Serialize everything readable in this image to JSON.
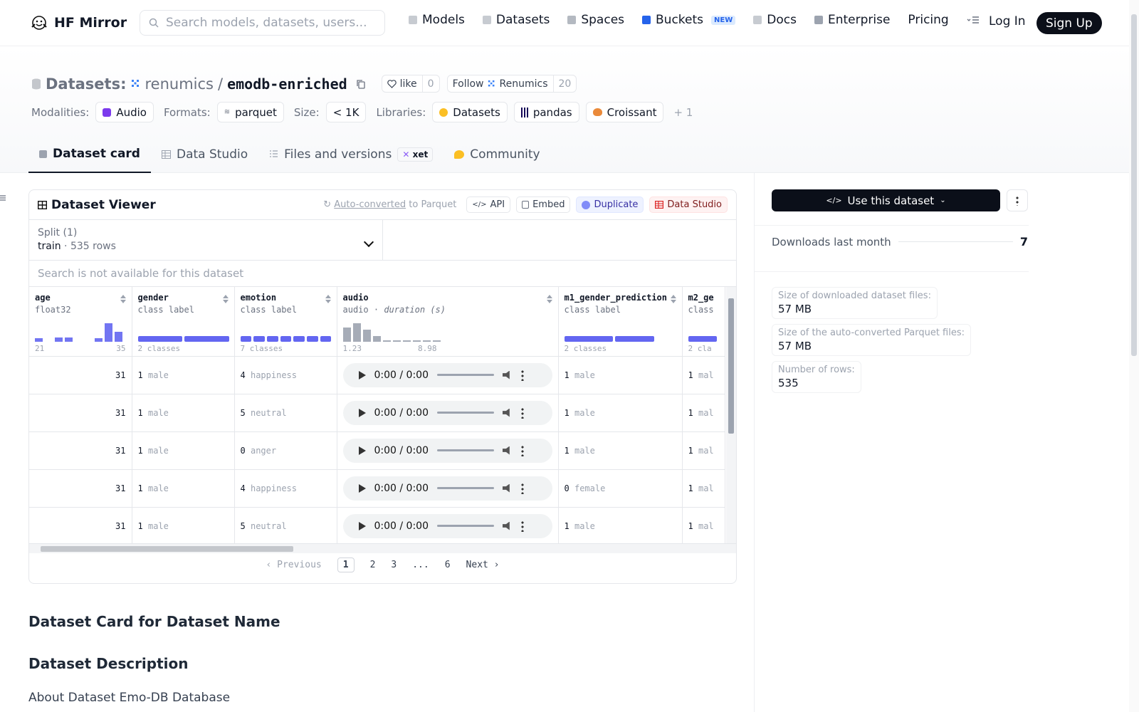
{
  "header": {
    "brand": "HF Mirror",
    "search_placeholder": "Search models, datasets, users...",
    "nav": [
      {
        "label": "Models",
        "color": "#9ca3af"
      },
      {
        "label": "Datasets",
        "color": "#9ca3af"
      },
      {
        "label": "Spaces",
        "color": "#9ca3af"
      },
      {
        "label": "Buckets",
        "color": "#2563eb",
        "badge": "NEW"
      },
      {
        "label": "Docs",
        "color": "#9ca3af"
      },
      {
        "label": "Enterprise",
        "color": "#9ca3af"
      },
      {
        "label": "Pricing",
        "color": ""
      }
    ],
    "login": "Log In",
    "signup": "Sign Up"
  },
  "dataset": {
    "prefix": "Datasets:",
    "org": "renumics",
    "name": "emodb-enriched",
    "like_label": "like",
    "like_count": "0",
    "follow_label": "Follow",
    "follow_org": "Renumics",
    "follow_count": "20",
    "meta": {
      "modalities_label": "Modalities:",
      "modality": "Audio",
      "formats_label": "Formats:",
      "format": "parquet",
      "size_label": "Size:",
      "size": "< 1K",
      "libraries_label": "Libraries:",
      "libraries": [
        "Datasets",
        "pandas",
        "Croissant"
      ],
      "more": "+ 1"
    },
    "tabs": [
      "Dataset card",
      "Data Studio",
      "Files and versions",
      "Community"
    ],
    "xet": "xet"
  },
  "viewer": {
    "title": "Dataset Viewer",
    "autoconv_link": "Auto-converted",
    "autoconv_rest": "to Parquet",
    "buttons": [
      "API",
      "Embed",
      "Duplicate",
      "Data Studio"
    ],
    "split_label": "Split (1)",
    "split_name": "train",
    "split_sep": "·",
    "split_rows": "535 rows",
    "search_placeholder": "Search is not available for this dataset",
    "columns": [
      {
        "name": "age",
        "type": "float32",
        "range_min": "21",
        "range_max": "35",
        "hist": [
          0.15,
          0,
          0.2,
          0.2,
          0,
          0,
          0.15,
          0.85,
          0.45
        ]
      },
      {
        "name": "gender",
        "type": "class label",
        "classes": "2 classes",
        "segments": [
          1,
          1
        ]
      },
      {
        "name": "emotion",
        "type": "class label",
        "classes": "7 classes",
        "segments": [
          1,
          1,
          1,
          1,
          1,
          1,
          1
        ]
      },
      {
        "name": "audio",
        "type": "audio",
        "type_extra": "duration (s)",
        "range_min": "1.23",
        "range_max": "8.98",
        "hist": [
          0.65,
          0.85,
          0.55,
          0.25,
          0.05,
          0.04,
          0.03,
          0.03,
          0.02,
          0.02
        ]
      },
      {
        "name": "m1_gender_prediction",
        "type": "class label",
        "classes": "2 classes",
        "segments": [
          1,
          0.8
        ]
      },
      {
        "name": "m2_ge",
        "type": "class",
        "classes": "2 cla",
        "segments": [
          1
        ]
      }
    ],
    "rows": [
      {
        "age": "31",
        "gender_code": "1",
        "gender": "male",
        "emotion_code": "4",
        "emotion": "happiness",
        "audio_time": "0:00 / 0:00",
        "m1_code": "1",
        "m1": "male",
        "m2_code": "1",
        "m2": "mal"
      },
      {
        "age": "31",
        "gender_code": "1",
        "gender": "male",
        "emotion_code": "5",
        "emotion": "neutral",
        "audio_time": "0:00 / 0:00",
        "m1_code": "1",
        "m1": "male",
        "m2_code": "1",
        "m2": "mal"
      },
      {
        "age": "31",
        "gender_code": "1",
        "gender": "male",
        "emotion_code": "0",
        "emotion": "anger",
        "audio_time": "0:00 / 0:00",
        "m1_code": "1",
        "m1": "male",
        "m2_code": "1",
        "m2": "mal"
      },
      {
        "age": "31",
        "gender_code": "1",
        "gender": "male",
        "emotion_code": "4",
        "emotion": "happiness",
        "audio_time": "0:00 / 0:00",
        "m1_code": "0",
        "m1": "female",
        "m2_code": "1",
        "m2": "mal"
      },
      {
        "age": "31",
        "gender_code": "1",
        "gender": "male",
        "emotion_code": "5",
        "emotion": "neutral",
        "audio_time": "0:00 / 0:00",
        "m1_code": "1",
        "m1": "male",
        "m2_code": "1",
        "m2": "mal"
      }
    ],
    "pager": {
      "prev": "Previous",
      "pages": [
        "1",
        "2",
        "3",
        "...",
        "6"
      ],
      "current": "1",
      "next": "Next"
    }
  },
  "card": {
    "h1": "Dataset Card for Dataset Name",
    "h2": "Dataset Description",
    "p": "About Dataset Emo-DB Database"
  },
  "sidebar": {
    "use_button": "Use this dataset",
    "downloads_label": "Downloads last month",
    "downloads_value": "7",
    "stats": [
      {
        "label": "Size of downloaded dataset files:",
        "value": "57 MB"
      },
      {
        "label": "Size of the auto-converted Parquet files:",
        "value": "57 MB"
      },
      {
        "label": "Number of rows:",
        "value": "535"
      }
    ]
  }
}
